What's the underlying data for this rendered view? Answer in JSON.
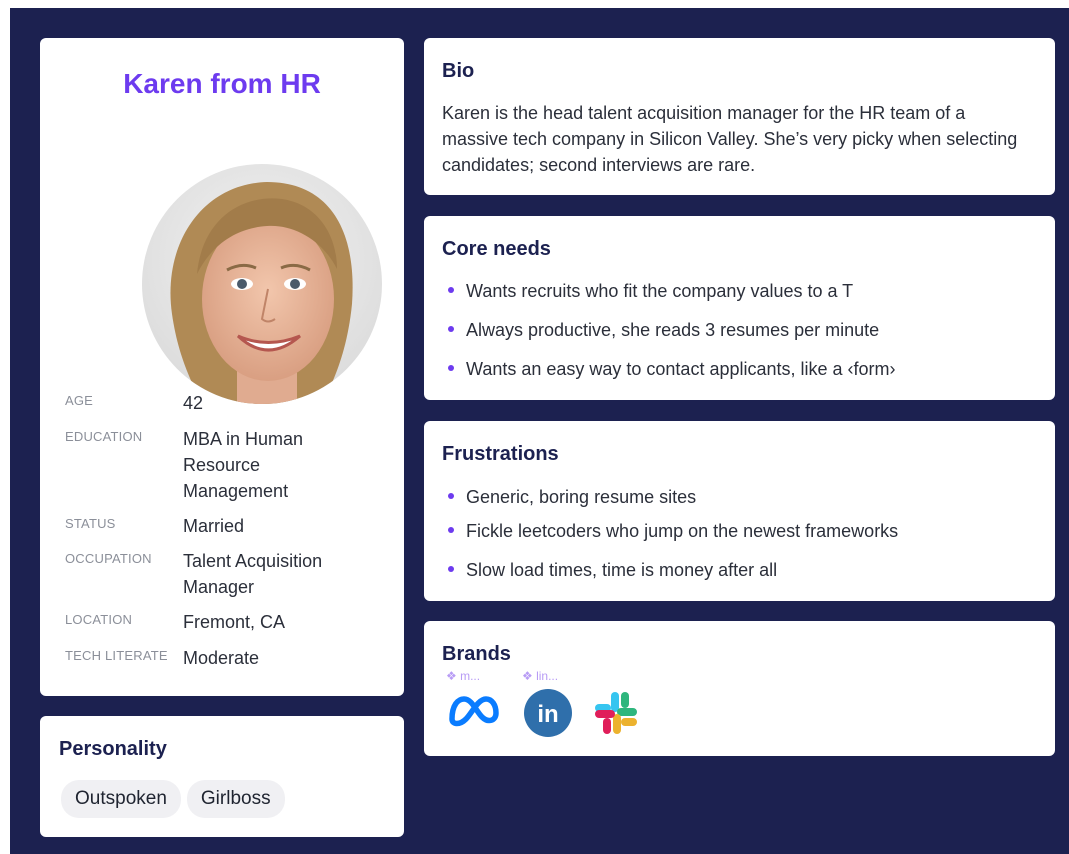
{
  "profile": {
    "name": "Karen from HR",
    "info": [
      {
        "label": "AGE",
        "value": "42"
      },
      {
        "label": "EDUCATION",
        "value": "MBA in Human Resource Management"
      },
      {
        "label": "STATUS",
        "value": "Married"
      },
      {
        "label": "OCCUPATION",
        "value": "Talent Acquisition Manager"
      },
      {
        "label": "LOCATION",
        "value": "Fremont, CA"
      },
      {
        "label": "TECH LITERATE",
        "value": "Moderate"
      }
    ]
  },
  "personality": {
    "title": "Personality",
    "tags": [
      "Outspoken",
      "Girlboss"
    ]
  },
  "bio": {
    "title": "Bio",
    "text": "Karen is the head talent acquisition manager for the HR team of a massive tech company in Silicon Valley. She’s very picky when selecting candidates; second interviews are rare."
  },
  "core_needs": {
    "title": "Core needs",
    "items": [
      "Wants recruits who fit the company values to a T",
      "Always productive, she reads 3 resumes per minute",
      "Wants an easy way to contact applicants, like a ‹form›"
    ]
  },
  "frustrations": {
    "title": "Frustrations",
    "items": [
      "Generic, boring resume sites",
      "Fickle leetcoders who jump on the newest frameworks",
      "Slow load times, time is money after all"
    ]
  },
  "brands": {
    "title": "Brands",
    "items": [
      {
        "tag": "❖ m...",
        "icon": "meta-icon"
      },
      {
        "tag": "❖ lin...",
        "icon": "linkedin-icon"
      },
      {
        "tag": "",
        "icon": "slack-icon"
      }
    ]
  },
  "colors": {
    "background": "#1c2150",
    "accent": "#6d3bef",
    "meta": "#0a7cff",
    "linkedin": "#2f6fab"
  }
}
